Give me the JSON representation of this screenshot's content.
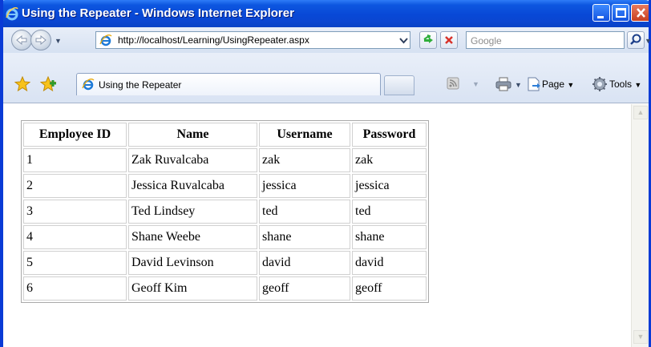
{
  "window": {
    "title": "Using the Repeater - Windows Internet Explorer"
  },
  "address_bar": {
    "url": "http://localhost/Learning/UsingRepeater.aspx",
    "search_placeholder": "Google"
  },
  "tabs": [
    {
      "label": "Using the Repeater"
    }
  ],
  "command_bar": {
    "page_label": "Page",
    "tools_label": "Tools"
  },
  "table": {
    "headers": [
      "Employee ID",
      "Name",
      "Username",
      "Password"
    ],
    "rows": [
      [
        "1",
        "Zak Ruvalcaba",
        "zak",
        "zak"
      ],
      [
        "2",
        "Jessica Ruvalcaba",
        "jessica",
        "jessica"
      ],
      [
        "3",
        "Ted Lindsey",
        "ted",
        "ted"
      ],
      [
        "4",
        "Shane Weebe",
        "shane",
        "shane"
      ],
      [
        "5",
        "David Levinson",
        "david",
        "david"
      ],
      [
        "6",
        "Geoff Kim",
        "geoff",
        "geoff"
      ]
    ]
  },
  "colors": {
    "titlebar": "#0848d6",
    "close_button": "#c8401f"
  }
}
